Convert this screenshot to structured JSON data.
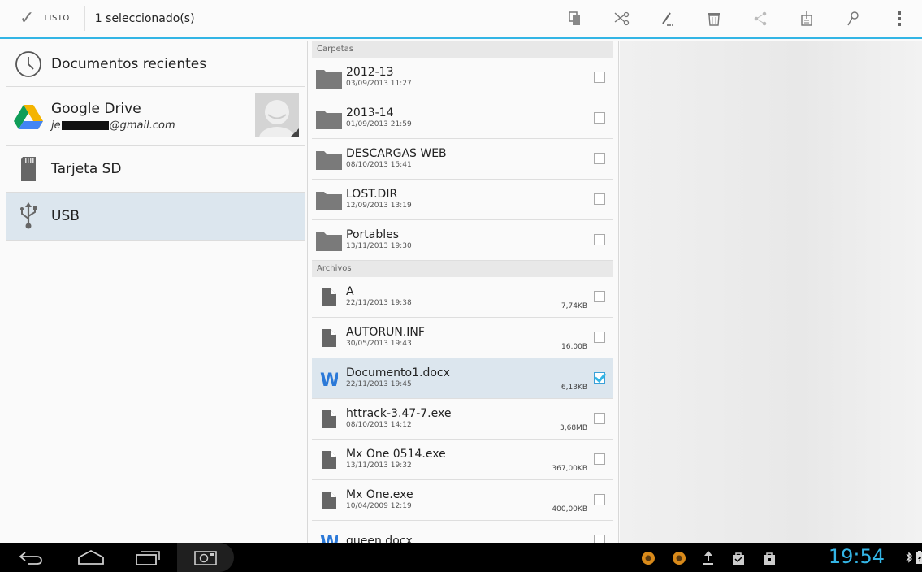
{
  "actionbar": {
    "done_label": "LISTO",
    "selection_text": "1 seleccionado(s)",
    "actions": [
      "copy-icon",
      "cut-icon",
      "rename-icon",
      "delete-icon",
      "share-icon",
      "compress-icon",
      "bookmark-icon",
      "overflow-menu-icon"
    ]
  },
  "nav": {
    "recent": "Documentos recientes",
    "drive_title": "Google Drive",
    "drive_account_prefix": "je",
    "drive_account_suffix": "@gmail.com",
    "sd": "Tarjeta SD",
    "usb": "USB"
  },
  "list": {
    "folders_header": "Carpetas",
    "files_header": "Archivos",
    "folders": [
      {
        "name": "2012-13",
        "date": "03/09/2013 11:27"
      },
      {
        "name": "2013-14",
        "date": "01/09/2013 21:59"
      },
      {
        "name": "DESCARGAS WEB",
        "date": "08/10/2013 15:41"
      },
      {
        "name": "LOST.DIR",
        "date": "12/09/2013 13:19"
      },
      {
        "name": "Portables",
        "date": "13/11/2013 19:30"
      }
    ],
    "files": [
      {
        "name": "A",
        "date": "22/11/2013 19:38",
        "size": "7,74KB"
      },
      {
        "name": "AUTORUN.INF",
        "date": "30/05/2013 19:43",
        "size": "16,00B"
      },
      {
        "name": "Documento1.docx",
        "date": "22/11/2013 19:45",
        "size": "6,13KB"
      },
      {
        "name": "httrack-3.47-7.exe",
        "date": "08/10/2013 14:12",
        "size": "3,68MB"
      },
      {
        "name": "Mx One 0514.exe",
        "date": "13/11/2013 19:32",
        "size": "367,00KB"
      },
      {
        "name": "Mx One.exe",
        "date": "10/04/2009 12:19",
        "size": "400,00KB"
      },
      {
        "name": "queen.docx",
        "date": "",
        "size": ""
      }
    ]
  },
  "system": {
    "clock": "19:54"
  },
  "colors": {
    "accent": "#33b5e5",
    "selected_bg": "#dce6ee"
  }
}
